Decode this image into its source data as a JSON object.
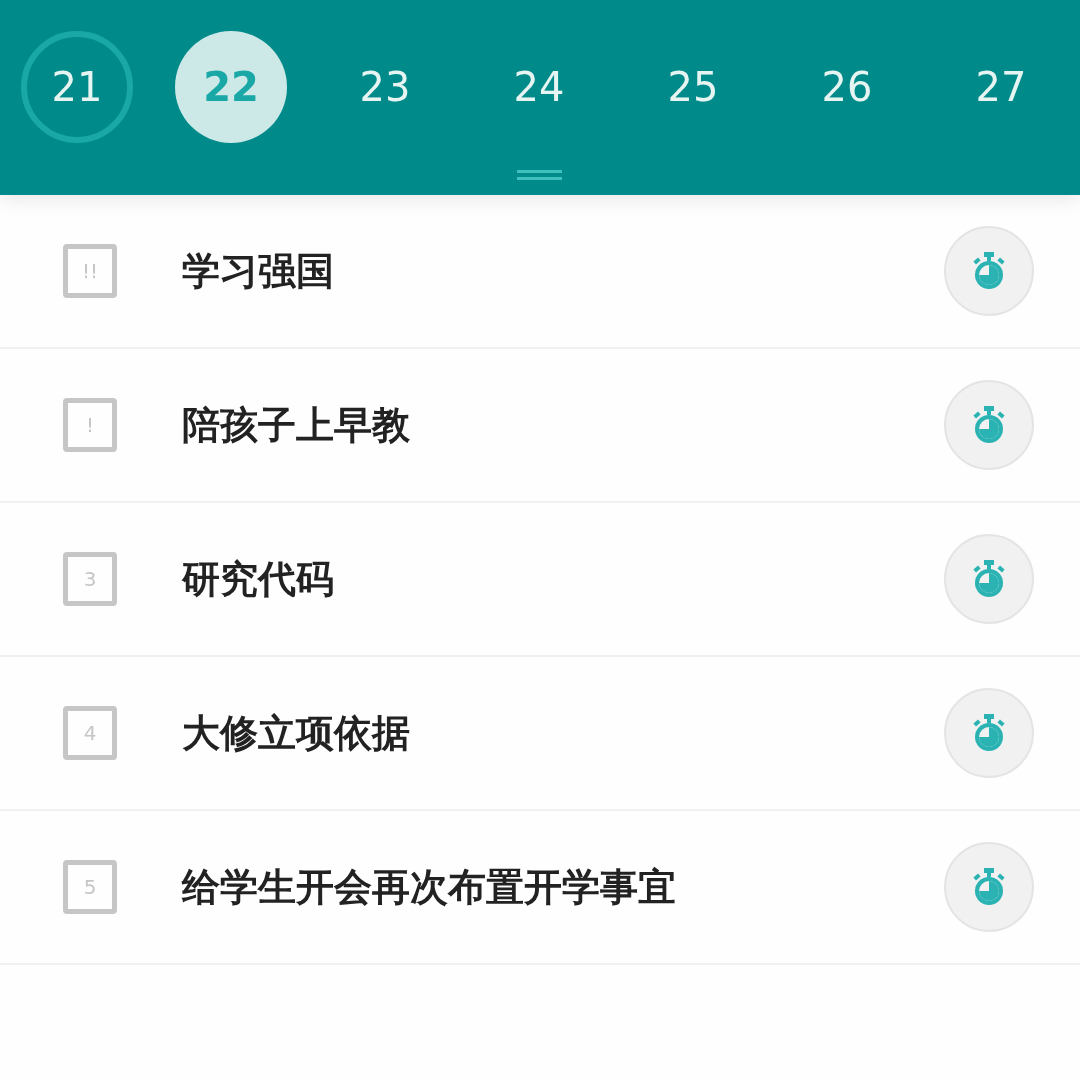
{
  "days": [
    {
      "label": "21",
      "selected": false,
      "today": true
    },
    {
      "label": "22",
      "selected": true,
      "today": false
    },
    {
      "label": "23",
      "selected": false,
      "today": false
    },
    {
      "label": "24",
      "selected": false,
      "today": false
    },
    {
      "label": "25",
      "selected": false,
      "today": false
    },
    {
      "label": "26",
      "selected": false,
      "today": false
    },
    {
      "label": "27",
      "selected": false,
      "today": false
    }
  ],
  "tasks": [
    {
      "priority": "!!",
      "title": "学习强国",
      "checked": false
    },
    {
      "priority": "!",
      "title": "陪孩子上早教",
      "checked": false
    },
    {
      "priority": "3",
      "title": "研究代码",
      "checked": false
    },
    {
      "priority": "4",
      "title": "大修立项依据",
      "checked": false
    },
    {
      "priority": "5",
      "title": "给学生开会再次布置开学事宜",
      "checked": false
    }
  ]
}
